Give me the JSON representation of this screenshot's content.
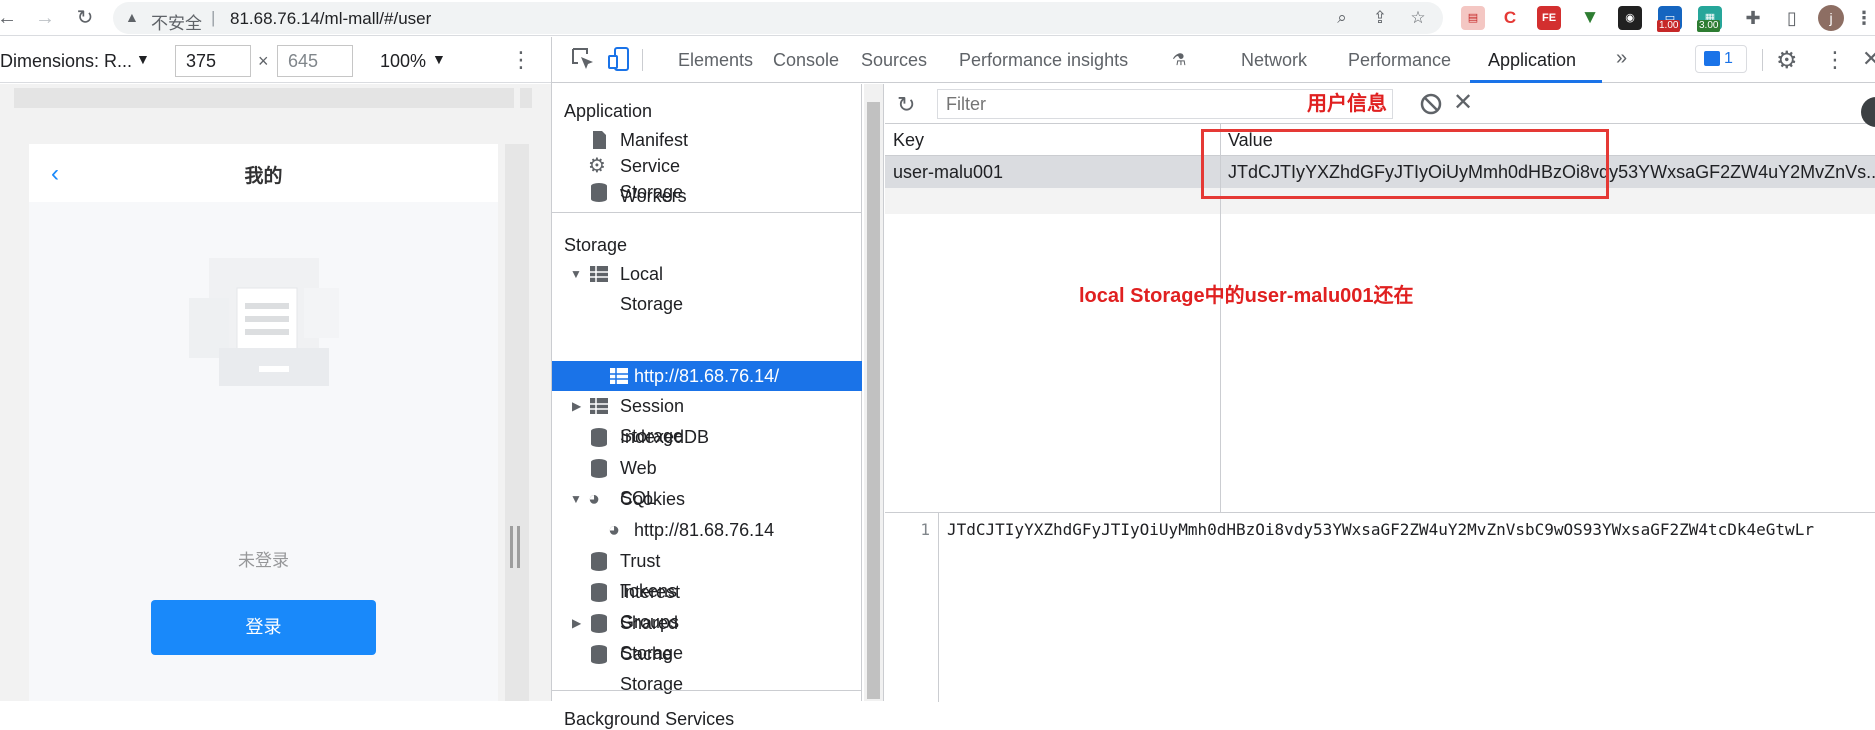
{
  "browser": {
    "security_label": "不安全",
    "url": "81.68.76.14/ml-mall/#/user",
    "ext_badges": [
      "1.00",
      "3.00"
    ],
    "profile_initial": "j"
  },
  "device_toolbar": {
    "dimensions_label": "Dimensions: R...",
    "width": "375",
    "height_placeholder": "645",
    "times": "×",
    "zoom": "100%"
  },
  "mobile": {
    "title": "我的",
    "status": "未登录",
    "login_label": "登录"
  },
  "devtools": {
    "tabs": [
      "Elements",
      "Console",
      "Sources",
      "Performance insights",
      "Network",
      "Performance",
      "Application"
    ],
    "more": "»",
    "issues_count": "1",
    "sidebar": {
      "application_header": "Application",
      "application_items": [
        "Manifest",
        "Service Workers",
        "Storage"
      ],
      "storage_header": "Storage",
      "local_storage": "Local Storage",
      "local_origin": "http://81.68.76.14/",
      "session_storage": "Session Storage",
      "indexeddb": "IndexedDB",
      "websql": "Web SQL",
      "cookies": "Cookies",
      "cookie_origin": "http://81.68.76.14",
      "trust_tokens": "Trust Tokens",
      "interest_groups": "Interest Groups",
      "shared_storage": "Shared Storage",
      "cache_storage": "Cache Storage",
      "background_services": "Background Services"
    },
    "filter_placeholder": "Filter",
    "table": {
      "key_header": "Key",
      "value_header": "Value",
      "rows": [
        {
          "key": "user-malu001",
          "value": "JTdCJTIyYXZhdGFyJTIyOiUyMmh0dHBzOi8vdy53YWxsaGF2ZW4uY2MvZnVs..."
        }
      ]
    },
    "preview_line_number": "1",
    "preview_text": "JTdCJTIyYXZhdGFyJTIyOiUyMmh0dHBzOi8vdy53YWxsaGF2ZW4uY2MvZnVsbC9wOS93YWxsaGF2ZW4tcDk4eGtwLr"
  },
  "annotations": {
    "user_info": "用户信息",
    "note": "local Storage中的user-malu001还在"
  }
}
